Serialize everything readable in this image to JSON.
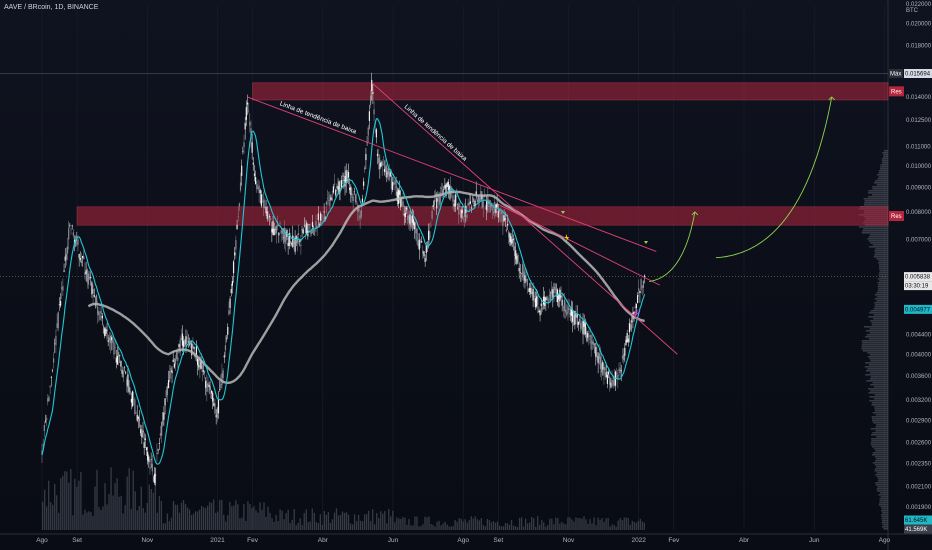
{
  "header": {
    "title": "AAVE / BRcoin, 1D, BINANCE"
  },
  "chart_data": {
    "type": "candlestick",
    "symbol": "AAVE / BRcoin, 1D, BINANCE",
    "currency_label": "BTC",
    "ylim": [
      0.0017,
      0.0218
    ],
    "y_ticks": [
      "0.022000",
      "0.020000",
      "0.018000",
      "0.015694",
      "0.014000",
      "0.012500",
      "0.011000",
      "0.010000",
      "0.009000",
      "0.008000",
      "0.007000",
      "0.005838",
      "0.004977",
      "0.004400",
      "0.004000",
      "0.003600",
      "0.003200",
      "0.002900",
      "0.002600",
      "0.002350",
      "0.002100",
      "0.001900"
    ],
    "y_tick_values": [
      0.022,
      0.02,
      0.018,
      0.015694,
      0.014,
      0.0125,
      0.011,
      0.01,
      0.009,
      0.008,
      0.007,
      0.005838,
      0.004977,
      0.0044,
      0.004,
      0.0036,
      0.0032,
      0.0029,
      0.0026,
      0.00235,
      0.0021,
      0.0019
    ],
    "x_ticks": [
      "Ago",
      "Set",
      "Nov",
      "2021",
      "Fev",
      "Abr",
      "Jun",
      "Ago",
      "Set",
      "Nov",
      "2022",
      "Fev",
      "Abr",
      "Jun",
      "Ago"
    ],
    "x_tick_months": [
      0,
      1,
      3,
      5,
      6,
      8,
      10,
      12,
      13,
      15,
      17,
      18,
      20,
      22,
      24
    ],
    "price_path": [
      [
        0,
        0.0025
      ],
      [
        0.8,
        0.0075
      ],
      [
        1.2,
        0.0062
      ],
      [
        1.8,
        0.0045
      ],
      [
        2.4,
        0.0036
      ],
      [
        3.0,
        0.0025
      ],
      [
        3.2,
        0.0022
      ],
      [
        3.6,
        0.0035
      ],
      [
        4.0,
        0.0043
      ],
      [
        4.4,
        0.004
      ],
      [
        4.8,
        0.0033
      ],
      [
        5.0,
        0.003
      ],
      [
        5.2,
        0.0039
      ],
      [
        5.4,
        0.0055
      ],
      [
        5.6,
        0.008
      ],
      [
        5.85,
        0.0138
      ],
      [
        6.1,
        0.0092
      ],
      [
        6.5,
        0.0075
      ],
      [
        6.9,
        0.0072
      ],
      [
        7.2,
        0.0068
      ],
      [
        7.6,
        0.0074
      ],
      [
        8.0,
        0.0078
      ],
      [
        8.3,
        0.0088
      ],
      [
        8.7,
        0.0095
      ],
      [
        9.1,
        0.0078
      ],
      [
        9.4,
        0.015
      ],
      [
        9.6,
        0.01
      ],
      [
        9.9,
        0.0095
      ],
      [
        10.3,
        0.0082
      ],
      [
        10.6,
        0.0075
      ],
      [
        10.9,
        0.0064
      ],
      [
        11.2,
        0.0084
      ],
      [
        11.6,
        0.009
      ],
      [
        12.0,
        0.0078
      ],
      [
        12.4,
        0.0087
      ],
      [
        12.7,
        0.0083
      ],
      [
        13.0,
        0.0081
      ],
      [
        13.3,
        0.0072
      ],
      [
        13.6,
        0.0062
      ],
      [
        13.9,
        0.0055
      ],
      [
        14.2,
        0.005
      ],
      [
        14.6,
        0.0055
      ],
      [
        15.0,
        0.0049
      ],
      [
        15.4,
        0.0046
      ],
      [
        15.8,
        0.004
      ],
      [
        16.1,
        0.0036
      ],
      [
        16.3,
        0.0035
      ],
      [
        16.6,
        0.004
      ],
      [
        16.8,
        0.0048
      ],
      [
        17.0,
        0.0054
      ],
      [
        17.2,
        0.005838
      ]
    ],
    "indicators": [
      {
        "kind": "moving-average",
        "color": "#21c7d6"
      },
      {
        "kind": "moving-average",
        "color": "#b9b9b9"
      }
    ],
    "resistance_zones": [
      {
        "label": "Res",
        "low": 0.0138,
        "high": 0.015,
        "from_month": 6.0,
        "to_month": 24.0
      },
      {
        "label": "Res",
        "low": 0.0075,
        "high": 0.0082,
        "from_month": 1.0,
        "to_month": 24.0
      }
    ],
    "trendlines": [
      {
        "label": "Linha de tendência de baixa",
        "from": [
          5.85,
          0.014
        ],
        "to": [
          17.5,
          0.0066
        ],
        "color": "#e0407a"
      },
      {
        "label": "Linha de tendência de baixa",
        "from": [
          9.4,
          0.015
        ],
        "to": [
          18.1,
          0.004
        ],
        "color": "#e0407a"
      },
      {
        "label": "",
        "from": [
          13.0,
          0.0083
        ],
        "to": [
          17.6,
          0.0056
        ],
        "color": "#e0407a"
      }
    ],
    "projections": [
      {
        "from": [
          17.3,
          0.0057
        ],
        "to": [
          18.6,
          0.008
        ],
        "color": "#8ed64f"
      },
      {
        "from": [
          19.2,
          0.0064
        ],
        "to": [
          22.5,
          0.014
        ],
        "color": "#8ed64f"
      }
    ],
    "price_tags": [
      {
        "label": "Máx",
        "value": "0.015694",
        "bg": "#d8dbe3",
        "fg": "#0b0e17"
      },
      {
        "label": "",
        "value": "0.005838",
        "bg": "#e8e8e8",
        "fg": "#0b0e17"
      },
      {
        "label": "",
        "value": "03:30:19",
        "bg": "#e8e8e8",
        "fg": "#0b0e17"
      },
      {
        "label": "",
        "value": "0.004977",
        "bg": "#1fb8c6",
        "fg": "#0b0e17"
      },
      {
        "label": "",
        "value": "61.645K",
        "bg": "#1fb8c6",
        "fg": "#0b0e17"
      },
      {
        "label": "",
        "value": "41.569K",
        "bg": "#3a3f4b",
        "fg": "#ffffff"
      }
    ]
  }
}
